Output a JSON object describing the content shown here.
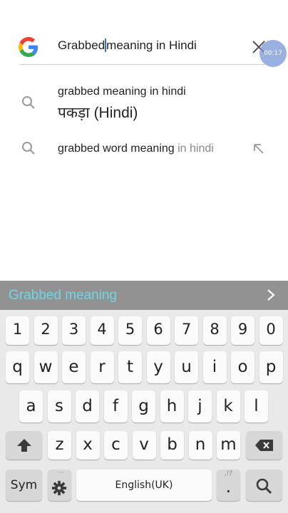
{
  "search": {
    "query_before_cursor": "Grabbed",
    "query_after_cursor": "meaning in Hindi",
    "logo_icon": "google-g-icon",
    "clear_icon": "close-icon"
  },
  "recording_timer": "00:17",
  "suggestions": [
    {
      "title": "grabbed meaning in hindi",
      "subtitle": "पकड़ा (Hindi)",
      "icon": "search-icon"
    },
    {
      "text_main": "grabbed word meaning",
      "text_muted": " in hindi",
      "icon": "search-icon",
      "action_icon": "arrow-up-left-icon"
    }
  ],
  "prediction_bar": {
    "word": "Grabbed meaning",
    "color": "#6fd6e8",
    "arrow_icon": "chevron-right-icon"
  },
  "keyboard": {
    "number_row": [
      "1",
      "2",
      "3",
      "4",
      "5",
      "6",
      "7",
      "8",
      "9",
      "0"
    ],
    "row1": [
      "q",
      "w",
      "e",
      "r",
      "t",
      "y",
      "u",
      "i",
      "o",
      "p"
    ],
    "row2": [
      "a",
      "s",
      "d",
      "f",
      "g",
      "h",
      "j",
      "k",
      "l"
    ],
    "row3": [
      "z",
      "x",
      "c",
      "v",
      "b",
      "n",
      "m"
    ],
    "shift_icon": "shift-arrow-icon",
    "backspace_icon": "backspace-icon",
    "sym_label": "Sym",
    "settings_icon": "gear-icon",
    "space_label": "English(UK)",
    "period_label": ".",
    "period_hint": ",!?",
    "search_icon": "search-icon"
  }
}
